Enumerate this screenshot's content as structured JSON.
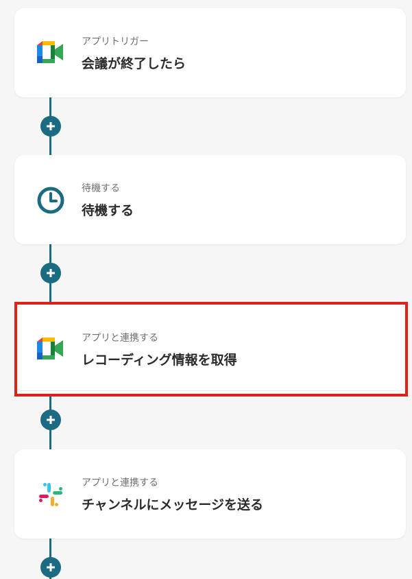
{
  "steps": [
    {
      "subtitle": "アプリトリガー",
      "title": "会議が終了したら",
      "icon": "google-meet-icon"
    },
    {
      "subtitle": "待機する",
      "title": "待機する",
      "icon": "clock-icon"
    },
    {
      "subtitle": "アプリと連携する",
      "title": "レコーディング情報を取得",
      "icon": "google-meet-icon"
    },
    {
      "subtitle": "アプリと連携する",
      "title": "チャンネルにメッセージを送る",
      "icon": "slack-icon"
    }
  ],
  "colors": {
    "connector": "#1b6b82",
    "highlight_border": "#e0201b",
    "background": "#f6f6f6"
  },
  "add_button_icon": "plus-icon"
}
